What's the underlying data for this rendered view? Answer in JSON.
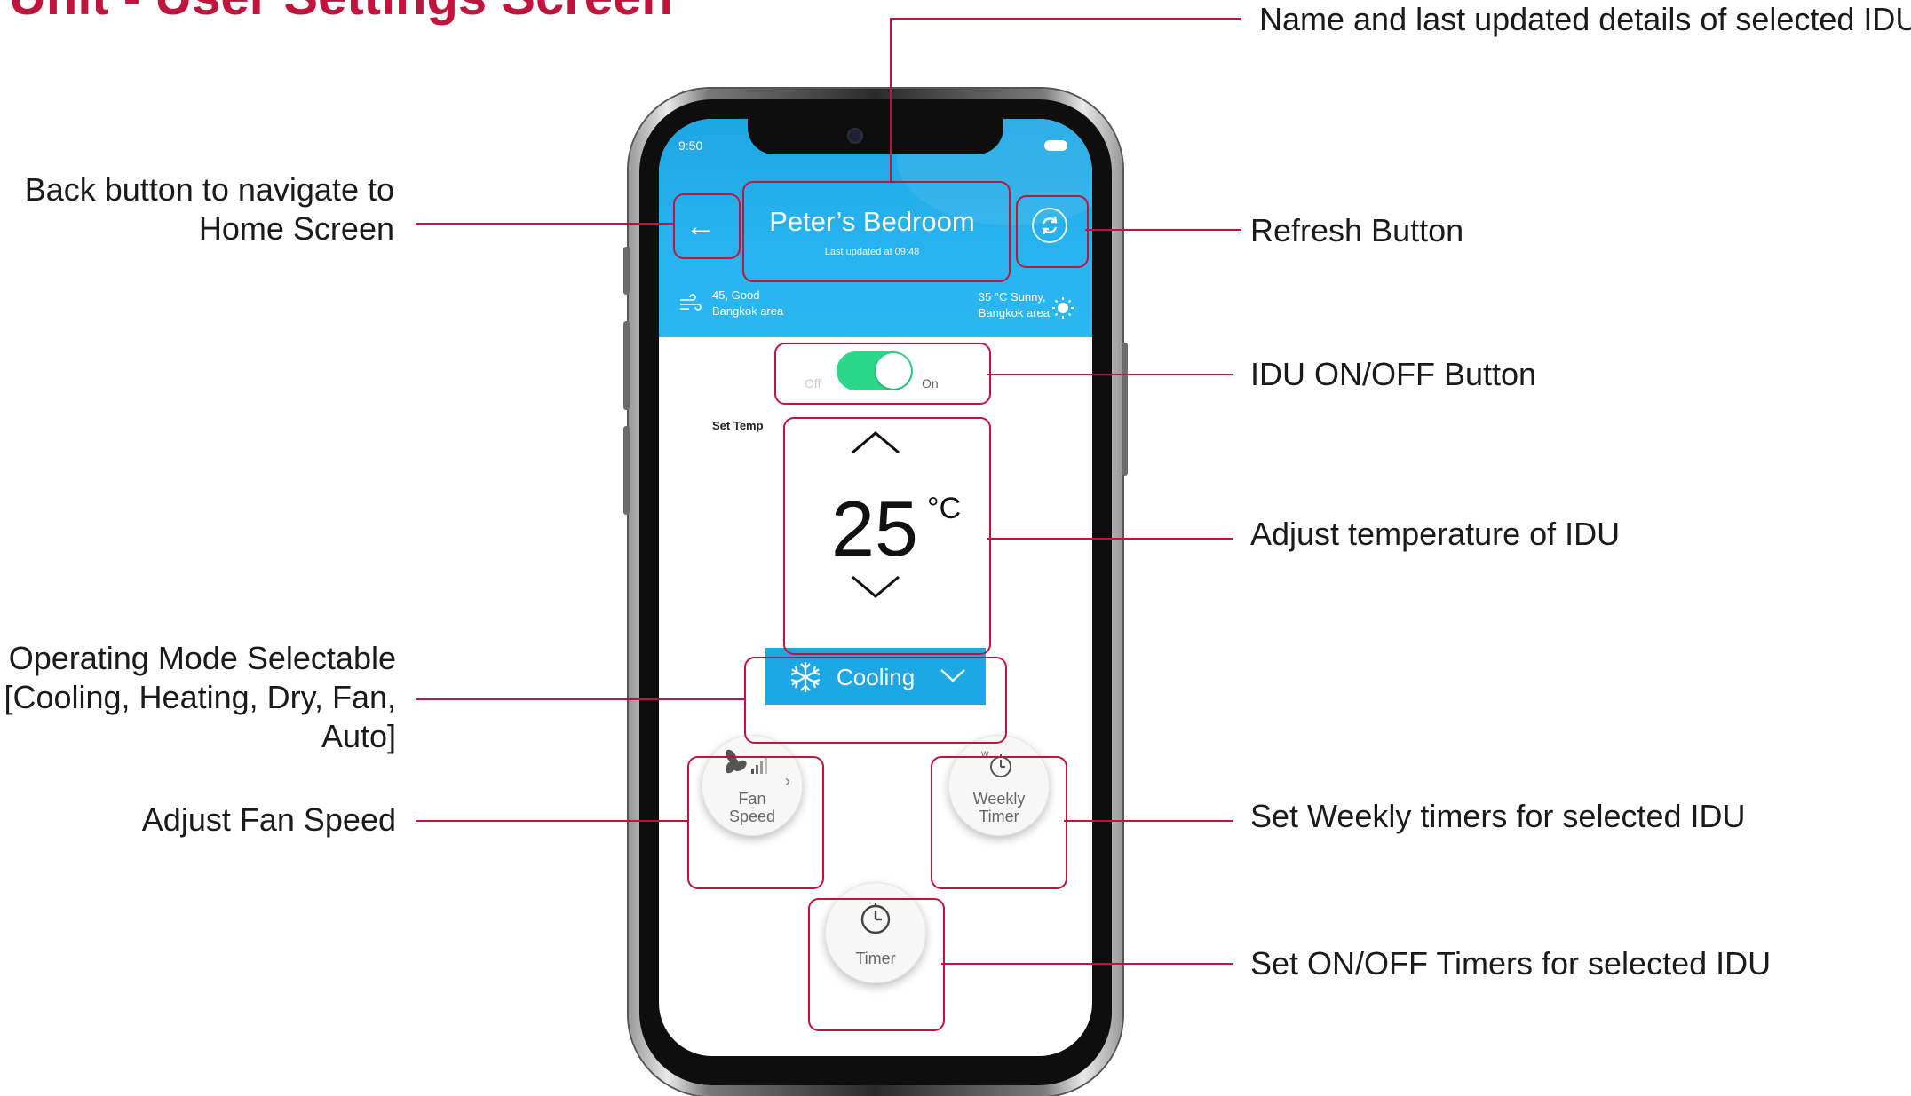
{
  "slide": {
    "title": "Unit - User Settings Screen"
  },
  "callouts": {
    "name_details": "Name and last updated details of selected IDU",
    "back_line1": "Back button to navigate to",
    "back_line2": "Home Screen",
    "refresh": "Refresh Button",
    "onoff": "IDU ON/OFF Button",
    "temperature": "Adjust temperature of IDU",
    "mode_line1": "Operating Mode Selectable",
    "mode_line2": "[Cooling, Heating, Dry, Fan,",
    "mode_line3": "Auto]",
    "fan_speed": "Adjust Fan Speed",
    "weekly": "Set Weekly timers for selected IDU",
    "timers": "Set ON/OFF Timers for selected IDU"
  },
  "app": {
    "status_time": "9:50",
    "room_name": "Peter’s Bedroom",
    "last_updated": "Last updated at 09:48",
    "air_quality_line1": "45, Good",
    "air_quality_line2": "Bangkok area",
    "weather_line1": "35 °C Sunny,",
    "weather_line2": "Bangkok area",
    "toggle_off": "Off",
    "toggle_on": "On",
    "toggle_state_on": true,
    "set_temp_label": "Set Temp",
    "temperature": "25",
    "temperature_unit": "°C",
    "mode": "Cooling",
    "fan_speed_line1": "Fan",
    "fan_speed_line2": "Speed",
    "weekly_timer_line1": "Weekly",
    "weekly_timer_line2": "Timer",
    "timer_label": "Timer"
  },
  "colors": {
    "accent_red": "#c0143c",
    "header_blue": "#1ea7e5",
    "toggle_green": "#2bd889"
  },
  "icons": {
    "back": "left-arrow-icon",
    "refresh": "refresh-icon",
    "air_quality": "wind-icon",
    "weather": "sun-icon",
    "temp_up": "chevron-up-icon",
    "temp_down": "chevron-down-icon",
    "mode": "snowflake-icon",
    "mode_dropdown": "chevron-down-icon",
    "fan_speed": "fan-icon",
    "weekly_timer": "weekly-clock-icon",
    "timer": "clock-icon"
  }
}
